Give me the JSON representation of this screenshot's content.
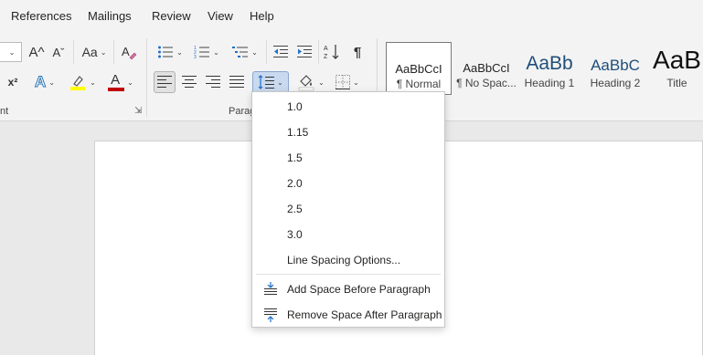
{
  "menu": {
    "tabs": [
      "References",
      "Mailings",
      "Review",
      "View",
      "Help"
    ]
  },
  "ribbon": {
    "font_group_label": "nt",
    "paragraph_group_label": "Parag",
    "superscript_label": "x²",
    "change_case_label": "Aa",
    "grow_font_label": "A^",
    "shrink_font_label": "Aˇ",
    "text_effects_label": "A",
    "font_color_label": "A",
    "pilcrow_label": "¶",
    "colors": {
      "highlight": "#ffff00",
      "font_color": "#c00000",
      "effects": "#2e75b6",
      "style_accent": "#1f4e79"
    }
  },
  "styles": [
    {
      "sample": "AaBbCcI",
      "name": "¶ Normal"
    },
    {
      "sample": "AaBbCcI",
      "name": "¶ No Spac..."
    },
    {
      "sample": "AaBb",
      "name": "Heading 1"
    },
    {
      "sample": "AaBbC",
      "name": "Heading 2"
    },
    {
      "sample": "AaB",
      "name": "Title"
    }
  ],
  "line_spacing_menu": {
    "options": [
      "1.0",
      "1.15",
      "1.5",
      "2.0",
      "2.5",
      "3.0"
    ],
    "more_options": "Line Spacing Options...",
    "add_space_before": "Add Space Before Paragraph",
    "remove_space_after": "Remove Space After Paragraph"
  }
}
